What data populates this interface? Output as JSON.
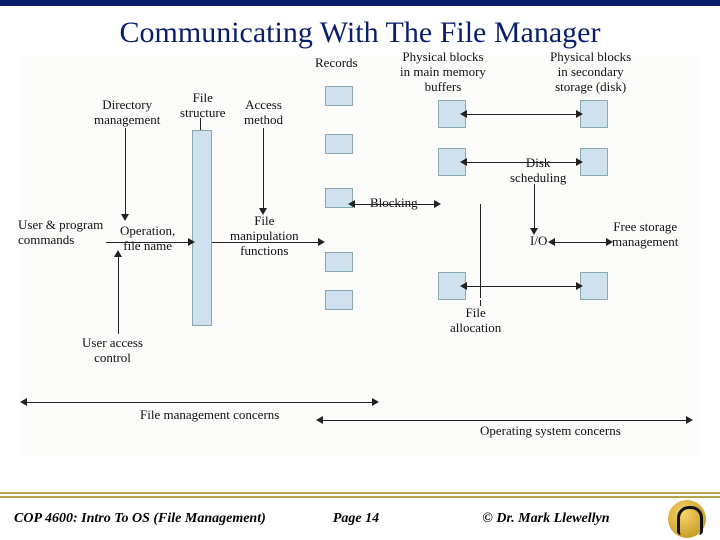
{
  "title": "Communicating With The File Manager",
  "diagram": {
    "labels": {
      "records": "Records",
      "mainmem": "Physical blocks\nin main memory\nbuffers",
      "secondary": "Physical blocks\nin secondary\nstorage (disk)",
      "dirmgmt": "Directory\nmanagement",
      "filestruct": "File\nstructure",
      "access": "Access\nmethod",
      "usercmd": "User & program\ncommands",
      "opname": "Operation,\nfile name",
      "filemanip": "File\nmanipulation\nfunctions",
      "blocking": "Blocking",
      "disksched": "Disk\nscheduling",
      "io": "I/O",
      "freestg": "Free storage\nmanagement",
      "uac": "User access\ncontrol",
      "filealloc": "File\nallocation",
      "fmc": "File management concerns",
      "osc": "Operating system concerns"
    }
  },
  "footer": {
    "left": "COP 4600: Intro To OS  (File Management)",
    "center": "Page 14",
    "right": "© Dr. Mark Llewellyn"
  }
}
